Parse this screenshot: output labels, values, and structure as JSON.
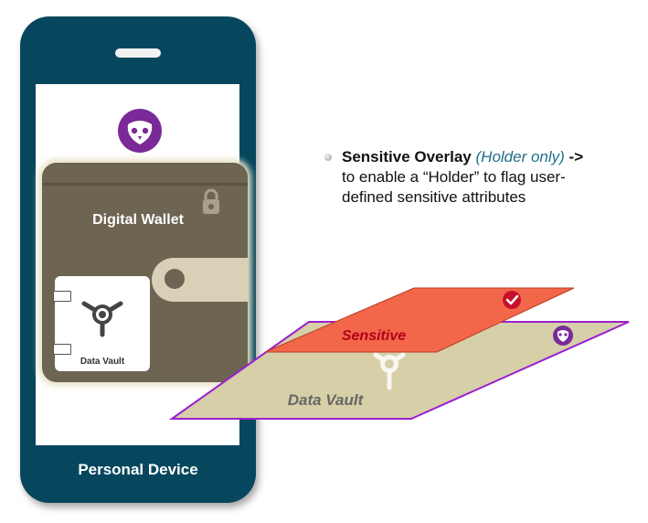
{
  "device": {
    "label": "Personal Device"
  },
  "wallet": {
    "title": "Digital Wallet"
  },
  "vault_card": {
    "label": "Data Vault"
  },
  "note": {
    "title": "Sensitive Overlay",
    "qualifier": "(Holder only)",
    "arrow": "->",
    "line2": "to enable a “Holder” to flag user-",
    "line3": "defined sensitive attributes"
  },
  "layers": {
    "base_label": "Data Vault",
    "overlay_label": "Sensitive"
  },
  "colors": {
    "phone": "#07475e",
    "wallet": "#6d6452",
    "base_layer": "#d6cfa8",
    "base_border": "#9b1fd1",
    "overlay_layer": "#f2674a",
    "overlay_label": "#b1001a",
    "owl": "#7a2a98"
  },
  "icons": [
    "owl-logo-icon",
    "lock-icon",
    "vault-dial-icon",
    "check-badge-icon"
  ]
}
